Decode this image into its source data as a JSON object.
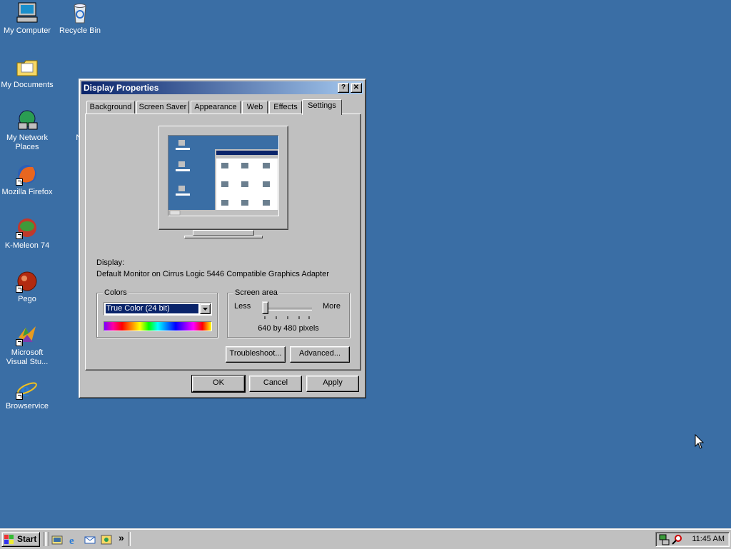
{
  "desktop": {
    "icons": [
      {
        "label": "My Computer"
      },
      {
        "label": "Recycle Bin"
      },
      {
        "label": "My Documents"
      },
      {
        "label": "My Network Places"
      },
      {
        "label": "Mozilla Firefox"
      },
      {
        "label": "K-Meleon 74"
      },
      {
        "label": "Pego"
      },
      {
        "label": "Microsoft Visual Stu..."
      },
      {
        "label": "Browservice"
      },
      {
        "label": "Note"
      }
    ]
  },
  "window": {
    "title": "Display Properties",
    "help_glyph": "?",
    "close_glyph": "✕",
    "tabs": [
      "Background",
      "Screen Saver",
      "Appearance",
      "Web",
      "Effects",
      "Settings"
    ],
    "active_tab": "Settings",
    "display_label": "Display:",
    "display_value": "Default Monitor on Cirrus Logic 5446 Compatible Graphics Adapter",
    "colors": {
      "group_label": "Colors",
      "selected": "True Color (24 bit)"
    },
    "screen_area": {
      "group_label": "Screen area",
      "less": "Less",
      "more": "More",
      "resolution": "640 by 480 pixels",
      "slider_position": 0
    },
    "troubleshoot": "Troubleshoot...",
    "advanced": "Advanced...",
    "ok": "OK",
    "cancel": "Cancel",
    "apply": "Apply"
  },
  "taskbar": {
    "start": "Start",
    "chevron": "»",
    "clock": "11:45 AM"
  },
  "colors": {
    "desktop": "#3a6ea5",
    "title_active": "#0a246a",
    "face": "#c0c0c0"
  }
}
